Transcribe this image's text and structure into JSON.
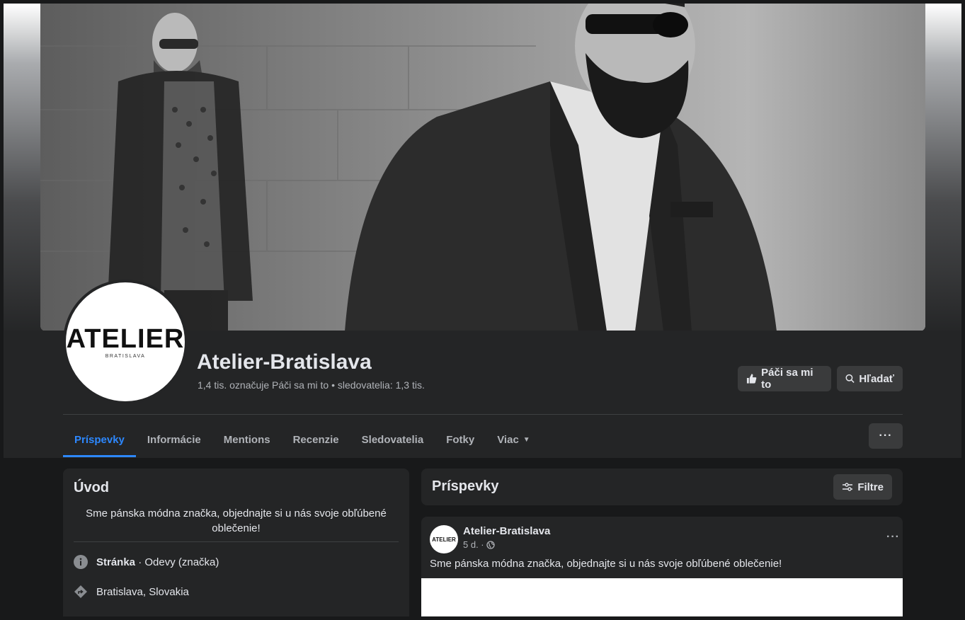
{
  "page": {
    "name": "Atelier-Bratislava",
    "stats": "1,4 tis. označuje Páči sa mi to • sledovatelia: 1,3 tis.",
    "logo_main": "ATELIER",
    "logo_sub": "BRATISLAVA"
  },
  "actions": {
    "like_label": "Páči sa mi to",
    "search_label": "Hľadať",
    "more_label": "···"
  },
  "tabs": [
    {
      "label": "Príspevky",
      "active": true
    },
    {
      "label": "Informácie"
    },
    {
      "label": "Mentions"
    },
    {
      "label": "Recenzie"
    },
    {
      "label": "Sledovatelia"
    },
    {
      "label": "Fotky"
    },
    {
      "label": "Viac"
    }
  ],
  "intro": {
    "title": "Úvod",
    "bio": "Sme pánska módna značka, objednajte si u nás svoje obľúbené oblečenie!",
    "category_label": "Stránka",
    "category_value": " · Odevy (značka)",
    "location": "Bratislava, Slovakia"
  },
  "posts_section": {
    "title": "Príspevky",
    "filter_label": "Filtre"
  },
  "post": {
    "author": "Atelier-Bratislava",
    "avatar_text": "ATELIER",
    "time": "5 d. ·",
    "text": "Sme pánska módna značka, objednajte si u nás svoje obľúbené oblečenie!",
    "more_label": "···"
  },
  "colors": {
    "accent": "#2d88ff",
    "card": "#242526",
    "background": "#18191a",
    "button": "#3a3b3c"
  }
}
